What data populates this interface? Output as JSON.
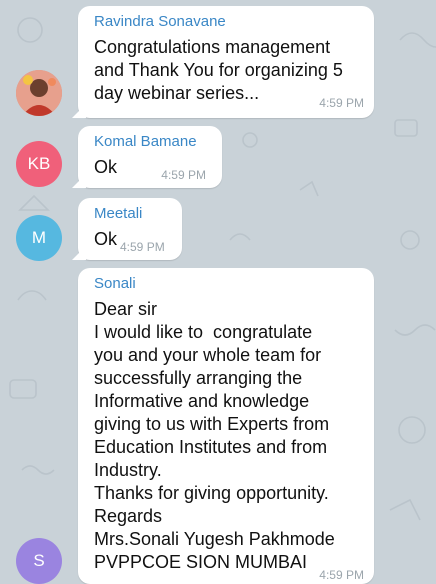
{
  "colors": {
    "background": "#c9d2d8",
    "bubble": "#ffffff",
    "time": "#9ba5ac",
    "sender_name": "#3a87c6",
    "avatar_kb": "#f0607a",
    "avatar_m": "#56b8e0",
    "avatar_s": "#9a84e0"
  },
  "messages": [
    {
      "sender": "Ravindra Sonavane",
      "avatar_icon": "user-photo-icon",
      "text": "Congratulations management\nand Thank You for organizing 5\nday webinar series...",
      "time": "4:59 PM"
    },
    {
      "sender": "Komal Bamane",
      "avatar_initials": "KB",
      "text": "Ok",
      "time": "4:59 PM"
    },
    {
      "sender": "Meetali",
      "avatar_initials": "M",
      "text": "Ok",
      "time": "4:59 PM"
    },
    {
      "sender": "Sonali",
      "avatar_initials": "S",
      "text": "Dear sir\nI would like to  congratulate\nyou and your whole team for\nsuccessfully arranging the\nInformative and knowledge\ngiving to us with Experts from\nEducation Institutes and from\nIndustry.\nThanks for giving opportunity.\nRegards\nMrs.Sonali Yugesh Pakhmode\nPVPPCOE SION MUMBAI",
      "time": "4:59 PM"
    }
  ]
}
